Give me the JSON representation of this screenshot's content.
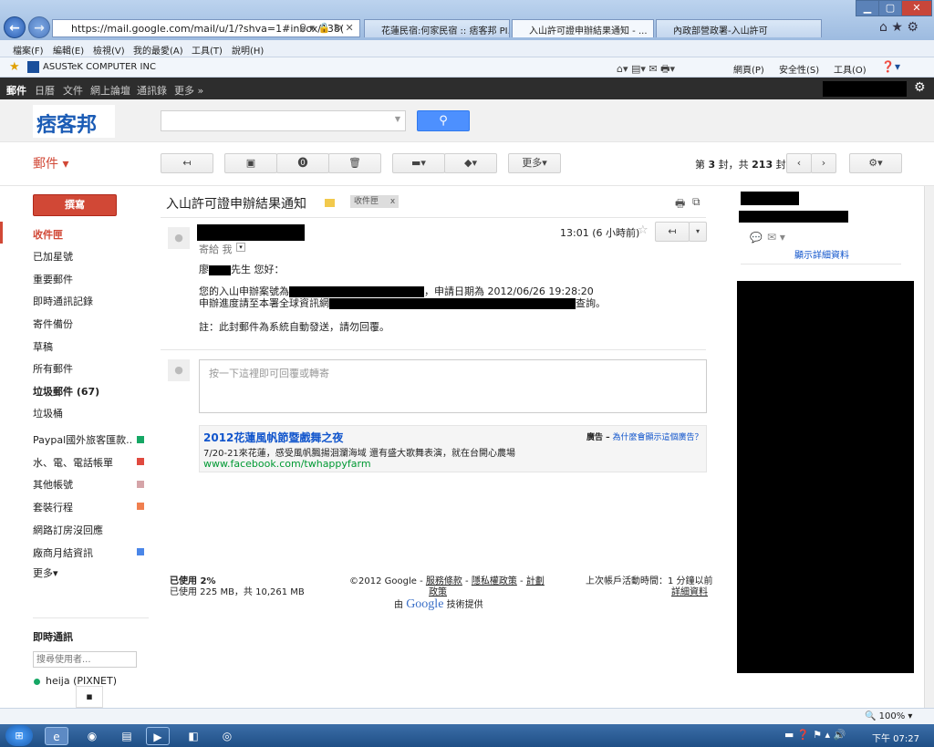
{
  "browser": {
    "address_url": "https://mail.google.com/mail/u/1/?shva=1#inbox/138(",
    "tabs": [
      "花蓮民宿:何家民宿 :: 痞客邦 PI...",
      "入山許可證申辦結果通知 - ...",
      "內政部營政署-入山許可"
    ],
    "menu": [
      "檔案(F)",
      "編輯(E)",
      "檢視(V)",
      "我的最愛(A)",
      "工具(T)",
      "說明(H)"
    ],
    "favorite": "ASUSTeK COMPUTER INC",
    "cmd_bar": [
      "網頁(P)",
      "安全性(S)",
      "工具(O)"
    ],
    "zoom": "100%"
  },
  "gbar": {
    "items": [
      "郵件",
      "日曆",
      "文件",
      "網上論壇",
      "通訊錄",
      "更多 »"
    ]
  },
  "logo": "痞客邦",
  "toolbar": {
    "more": "更多",
    "counter_prefix": "第 ",
    "counter_current": "3",
    "counter_mid": " 封，共 ",
    "counter_total": "213",
    "counter_suffix": " 封"
  },
  "sidebar": {
    "mail_label": "郵件",
    "compose": "撰寫",
    "items": [
      {
        "label": "收件匣",
        "active": true
      },
      {
        "label": "已加星號"
      },
      {
        "label": "重要郵件"
      },
      {
        "label": "即時通訊記錄"
      },
      {
        "label": "寄件備份"
      },
      {
        "label": "草稿"
      },
      {
        "label": "所有郵件"
      },
      {
        "label": "垃圾郵件 (67)",
        "bold": true
      },
      {
        "label": "垃圾桶"
      },
      {
        "label": "Paypal國外旅客匯款...",
        "color": "#16a765"
      },
      {
        "label": "水、電、電話帳單",
        "color": "#e04a3f"
      },
      {
        "label": "其他帳號",
        "color": "#d5a4a8"
      },
      {
        "label": "套裝行程",
        "color": "#f07f4f"
      },
      {
        "label": "網路訂房沒回應"
      },
      {
        "label": "廠商月結資訊",
        "color": "#4a86e8"
      }
    ],
    "more": "更多",
    "chat_title": "即時通訊",
    "chat_search_placeholder": "搜尋使用者...",
    "chat_user": "heija (PIXNET)"
  },
  "email": {
    "subject": "入山許可證申辦結果通知",
    "label": "收件匣",
    "time": "13:01 (6 小時前)",
    "to_me": "寄給 我",
    "greeting_a": "廖",
    "greeting_b": "先生 您好：",
    "line1_a": "您的入山申辦案號為",
    "line1_b": "，申請日期為 2012/06/26 19:28:20",
    "line2_a": "申辦進度請至本署全球資訊網",
    "line2_b": "查詢。",
    "note": "註：此封郵件為系統自動發送，請勿回覆。",
    "reply_placeholder": "按一下這裡即可回覆或轉寄"
  },
  "ad": {
    "title": "2012花蓮風帆節暨戲舞之夜",
    "text": "7/20-21來花蓮，感受風帆飄揚洄瀾海域 還有盛大歌舞表演，就在台開心農場",
    "url": "www.facebook.com/twhappyfarm",
    "tag": "廣告 –",
    "why": "為什麼會顯示這個廣告？"
  },
  "footer": {
    "usage_pct": "已使用 2%",
    "usage_detail": "已使用 225 MB，共 10,261 MB",
    "copyright": "©2012 Google -",
    "terms": "服務條款",
    "privacy": "隱私權政策",
    "program": "計劃",
    "policy": "政策",
    "powered_a": "由",
    "powered_b": "Google",
    "powered_c": "技術提供",
    "activity": "上次帳戶活動時間：1 分鐘以前",
    "details": "詳細資料"
  },
  "right_panel": {
    "show_details": "顯示詳細資料"
  },
  "taskbar": {
    "clock": "下午 07:27"
  }
}
